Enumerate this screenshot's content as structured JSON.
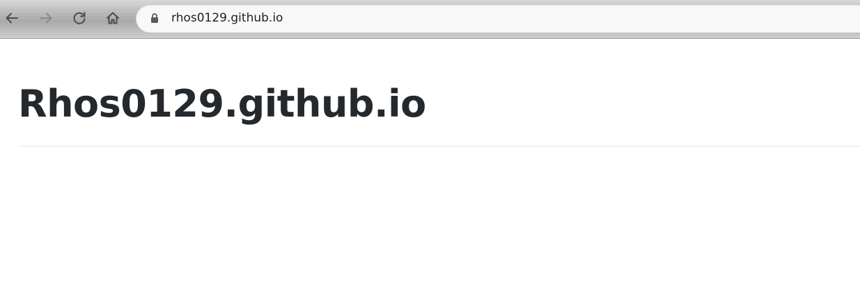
{
  "browser": {
    "toolbar": {
      "back": {
        "icon": "arrow-left-icon",
        "enabled": true
      },
      "forward": {
        "icon": "arrow-right-icon",
        "enabled": false
      },
      "reload": {
        "icon": "reload-icon"
      },
      "home": {
        "icon": "home-icon"
      }
    },
    "omnibox": {
      "secure_icon": "lock-icon",
      "url": "rhos0129.github.io"
    }
  },
  "page": {
    "title": "Rhos0129.github.io"
  },
  "colors": {
    "title_text": "#24292e",
    "url_text": "#202124",
    "icon_active": "#4a4a4a",
    "icon_disabled": "#8a8a8a",
    "divider": "#e6e8ea"
  }
}
